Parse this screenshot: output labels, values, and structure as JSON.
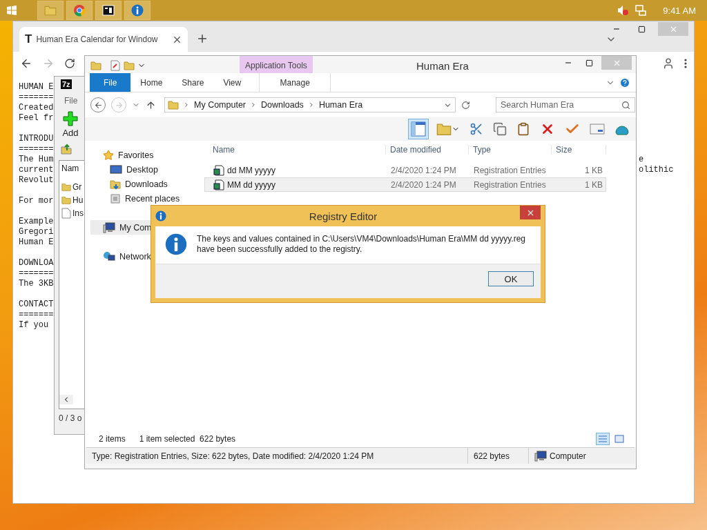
{
  "taskbar": {
    "buttons": [
      {
        "kind": "folder"
      },
      {
        "kind": "browser"
      },
      {
        "kind": "archive"
      },
      {
        "kind": "info"
      }
    ],
    "clock": "9:41 AM"
  },
  "browser": {
    "tab": {
      "favicon": "T",
      "title": "Human Era Calendar for Window"
    },
    "page_paragraphs": [
      [
        {
          "left": "HUMAN E"
        },
        {
          "left": "======="
        },
        {
          "left": "Created"
        },
        {
          "left": "Feel fr"
        }
      ],
      [
        {
          "left": "INTRODU"
        },
        {
          "left": "======="
        },
        {
          "left": "The Hum",
          "right": "e"
        },
        {
          "left": "current",
          "right": "olithic"
        },
        {
          "left": "Revolut"
        }
      ],
      [
        {
          "left": "For mor"
        }
      ],
      [
        {
          "left": "Example"
        },
        {
          "left": "Gregori"
        },
        {
          "left": "Human E"
        }
      ],
      [
        {
          "left": "DOWNLOA"
        },
        {
          "left": "======="
        },
        {
          "left": "The 3KB"
        }
      ],
      [
        {
          "left": "CONTACT"
        },
        {
          "left": "======="
        },
        {
          "left": "If you"
        }
      ]
    ]
  },
  "archiver": {
    "logo": "7z",
    "menu": "File",
    "add": "Add",
    "column": "Nam",
    "items": [
      {
        "kind": "folder",
        "name": "Gr"
      },
      {
        "kind": "folder",
        "name": "Hu"
      },
      {
        "kind": "file",
        "name": "Ins"
      }
    ],
    "status": "0 / 3 o"
  },
  "explorer": {
    "title": "Human Era",
    "context_label": "Application Tools",
    "ribbon_tabs": [
      {
        "label": "File",
        "kind": "file"
      },
      {
        "label": "Home",
        "kind": "tab"
      },
      {
        "label": "Share",
        "kind": "tab"
      },
      {
        "label": "View",
        "kind": "tab"
      },
      {
        "label": "Manage",
        "kind": "context"
      }
    ],
    "path": [
      "My Computer",
      "Downloads",
      "Human Era"
    ],
    "search": {
      "placeholder": "Search Human Era"
    },
    "nav": [
      {
        "label": "Favorites",
        "kind": "star",
        "selected": false,
        "children": [
          {
            "label": "Desktop",
            "kind": "desktop",
            "selected": false
          },
          {
            "label": "Downloads",
            "kind": "downloads",
            "selected": false
          },
          {
            "label": "Recent places",
            "kind": "recent",
            "selected": false
          }
        ]
      },
      {
        "label": "My Com",
        "kind": "computer",
        "selected": true
      },
      {
        "label": "Network",
        "kind": "network",
        "selected": false
      }
    ],
    "columns": [
      "Name",
      "Date modified",
      "Type",
      "Size"
    ],
    "files": [
      {
        "name": "dd MM yyyyy",
        "date": "2/4/2020 1:24 PM",
        "type": "Registration Entries",
        "size": "1 KB",
        "selected": false
      },
      {
        "name": "MM dd yyyyy",
        "date": "2/4/2020 1:24 PM",
        "type": "Registration Entries",
        "size": "1 KB",
        "selected": true
      }
    ],
    "item_count": "2 items",
    "selection": "1 item selected  622 bytes",
    "status_bar": {
      "details": "Type: Registration Entries, Size: 622 bytes, Date modified: 2/4/2020 1:24 PM",
      "size": "622 bytes",
      "zone": "Computer"
    }
  },
  "dialog": {
    "title": "Registry Editor",
    "message": "The keys and values contained in C:\\Users\\VM4\\Downloads\\Human Era\\MM dd yyyyy.reg have been successfully added to the registry.",
    "button": "OK"
  }
}
